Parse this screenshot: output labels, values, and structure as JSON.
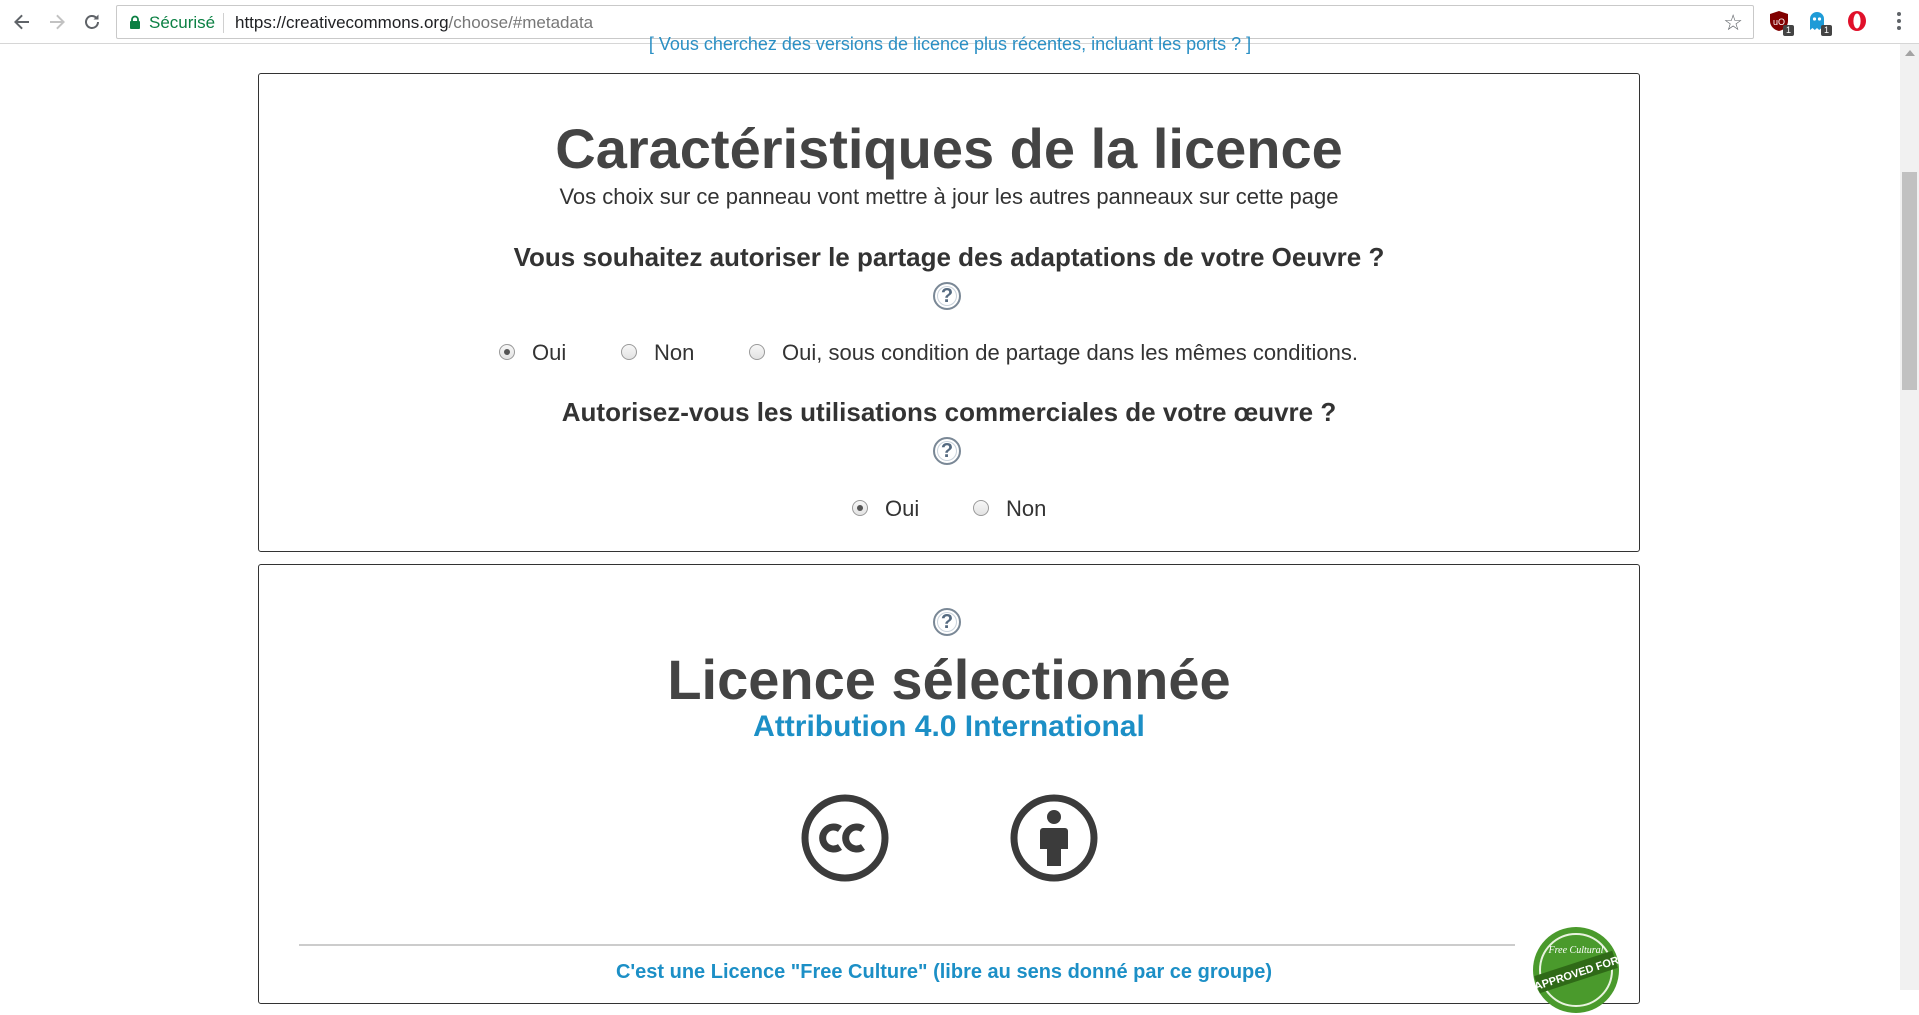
{
  "browser": {
    "secure_label": "Sécurisé",
    "url_host": "https://creativecommons.org",
    "url_path": "/choose/#metadata",
    "extensions": [
      {
        "name": "ublock-icon",
        "badge": "1",
        "color": "#800000"
      },
      {
        "name": "ghostery-icon",
        "badge": "1",
        "color": "#1e9bd7"
      },
      {
        "name": "opera-icon",
        "badge": "",
        "color": "#e0102a"
      }
    ]
  },
  "top_link": {
    "text": "[ Vous cherchez des versions de licence plus récentes, incluant les ports ? ]"
  },
  "features": {
    "title": "Caractéristiques de la licence",
    "subtitle": "Vos choix sur ce panneau vont mettre à jour les autres panneaux sur cette page",
    "help_symbol": "?",
    "q_adaptations": {
      "question": "Vous souhaitez autoriser le partage des adaptations de votre Oeuvre ?",
      "options": [
        "Oui",
        "Non",
        "Oui, sous condition de partage dans les mêmes conditions."
      ],
      "selected": "Oui"
    },
    "q_commercial": {
      "question": "Autorisez-vous les utilisations commerciales de votre œuvre ?",
      "options": [
        "Oui",
        "Non"
      ],
      "selected": "Oui"
    }
  },
  "selected_license": {
    "help_symbol": "?",
    "title": "Licence sélectionnée",
    "name": "Attribution 4.0 International",
    "icons": [
      "cc-icon",
      "attribution-icon"
    ],
    "free_culture_text": "C'est une Licence \"Free Culture\" (libre au sens donné par ce groupe)",
    "badge_text": [
      "Free Cultural",
      "APPROVED FOR"
    ]
  },
  "colors": {
    "link": "#1c8fc6",
    "heading": "#444444",
    "secure": "#0b8043",
    "badge_green": "#4a9a2c"
  }
}
